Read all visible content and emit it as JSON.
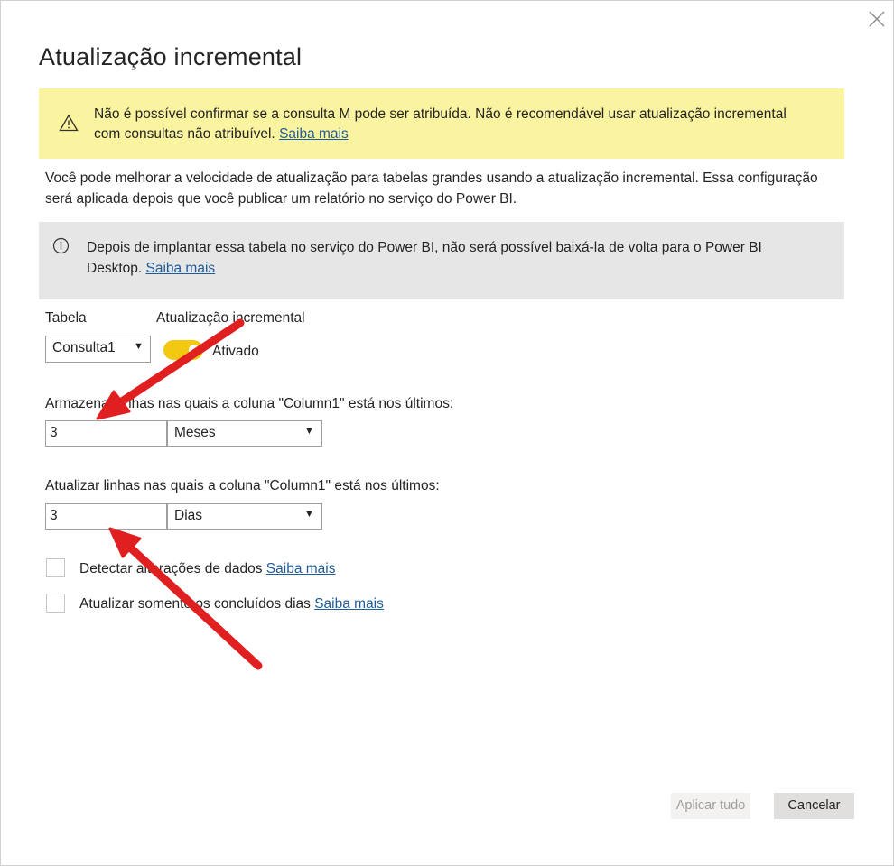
{
  "dialog": {
    "title": "Atualização incremental",
    "close_icon": "close-icon"
  },
  "warning": {
    "icon": "warning-triangle-icon",
    "text": "Não é possível confirmar se a consulta M pode ser atribuída. Não é recomendável usar atualização incremental com consultas não atribuível.",
    "link": "Saiba mais"
  },
  "description": "Você pode melhorar a velocidade de atualização para tabelas grandes usando a atualização incremental. Essa configuração será aplicada depois que você publicar um relatório no serviço do Power BI.",
  "info": {
    "icon": "info-icon",
    "text": "Depois de implantar essa tabela no serviço do Power BI, não será possível baixá-la de volta para o Power BI Desktop.",
    "link": "Saiba mais"
  },
  "table": {
    "label": "Tabela",
    "selected": "Consulta1",
    "caret": "▼"
  },
  "incremental": {
    "label": "Atualização incremental",
    "toggle_label": "Ativado",
    "enabled": true,
    "toggle_color": "#f2c811"
  },
  "store": {
    "label": "Armazenar linhas nas quais a coluna \"Column1\" está nos últimos:",
    "value": "3",
    "unit": "Meses",
    "caret": "▼"
  },
  "refresh": {
    "label": "Atualizar linhas nas quais a coluna \"Column1\" está nos últimos:",
    "value": "3",
    "unit": "Dias",
    "caret": "▼"
  },
  "options": {
    "detect_label": "Detectar alterações de dados",
    "detect_link": "Saiba mais",
    "detect_checked": false,
    "complete_label": "Atualizar somente os concluídos dias",
    "complete_link": "Saiba mais",
    "complete_checked": false
  },
  "buttons": {
    "apply": "Aplicar tudo",
    "cancel": "Cancelar"
  },
  "annotation_color": "#e02020"
}
